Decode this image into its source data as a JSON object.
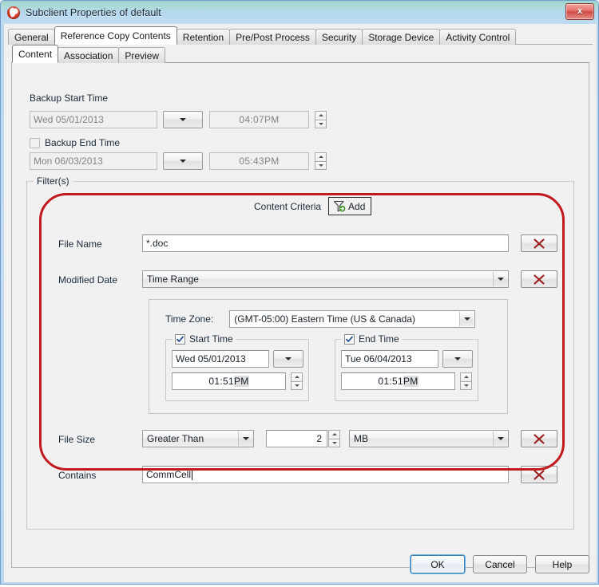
{
  "window": {
    "title": "Subclient Properties of default",
    "app_icon": "commvault-swirl-icon",
    "close_label": "x"
  },
  "tabs_outer": [
    {
      "label": "General",
      "active": false
    },
    {
      "label": "Reference Copy Contents",
      "active": true
    },
    {
      "label": "Retention",
      "active": false
    },
    {
      "label": "Pre/Post Process",
      "active": false
    },
    {
      "label": "Security",
      "active": false
    },
    {
      "label": "Storage Device",
      "active": false
    },
    {
      "label": "Activity Control",
      "active": false
    }
  ],
  "tabs_inner": [
    {
      "label": "Content",
      "active": true
    },
    {
      "label": "Association",
      "active": false
    },
    {
      "label": "Preview",
      "active": false
    }
  ],
  "backup_start": {
    "group_label": "Backup Start Time",
    "date_value": "Wed 05/01/2013",
    "time_value": "04 : 07PM",
    "time_hour": "04",
    "time_sep": " : ",
    "time_minute": "07",
    "time_meridiem": "PM"
  },
  "backup_end": {
    "checkbox_label": "Backup End Time",
    "checked": false,
    "date_value": "Mon 06/03/2013",
    "time_hour": "05",
    "time_sep": " : ",
    "time_minute": "43",
    "time_meridiem": "PM"
  },
  "filters": {
    "group_label": "Filter(s)",
    "content_criteria_label": "Content Criteria",
    "add_label": "Add",
    "add_icon": "filter-add-icon",
    "rows": {
      "file_name": {
        "label": "File Name",
        "value": "*.doc",
        "delete_icon": "delete-x-icon"
      },
      "modified_date": {
        "label": "Modified Date",
        "value": "Time Range",
        "delete_icon": "delete-x-icon"
      },
      "file_size": {
        "label": "File Size",
        "operator": "Greater Than",
        "amount": "2",
        "unit": "MB",
        "delete_icon": "delete-x-icon"
      },
      "contains": {
        "label": "Contains",
        "value": "CommCell",
        "delete_icon": "delete-x-icon"
      }
    },
    "time_range": {
      "timezone_label": "Time Zone:",
      "timezone_value": "(GMT-05:00) Eastern Time (US & Canada)",
      "start": {
        "checkbox_label": "Start Time",
        "checked": true,
        "date_value": "Wed 05/01/2013",
        "time_hour": "01",
        "time_sep": " : ",
        "time_minute": "51",
        "time_meridiem": "PM"
      },
      "end": {
        "checkbox_label": "End Time",
        "checked": true,
        "date_value": "Tue 06/04/2013",
        "time_hour": "01",
        "time_sep": " : ",
        "time_minute": "51",
        "time_meridiem": "PM"
      }
    }
  },
  "buttons": {
    "ok": "OK",
    "cancel": "Cancel",
    "help": "Help"
  },
  "annotation": {
    "type": "red-rounded-rect-highlight",
    "color": "#c1191c"
  },
  "colors": {
    "accent_red": "#c1191c",
    "title_gradient_start": "#9fd3cd",
    "title_gradient_end": "#bedcf2",
    "dialog_face": "#f0f0f0",
    "focus_blue": "#3c7fb1"
  }
}
